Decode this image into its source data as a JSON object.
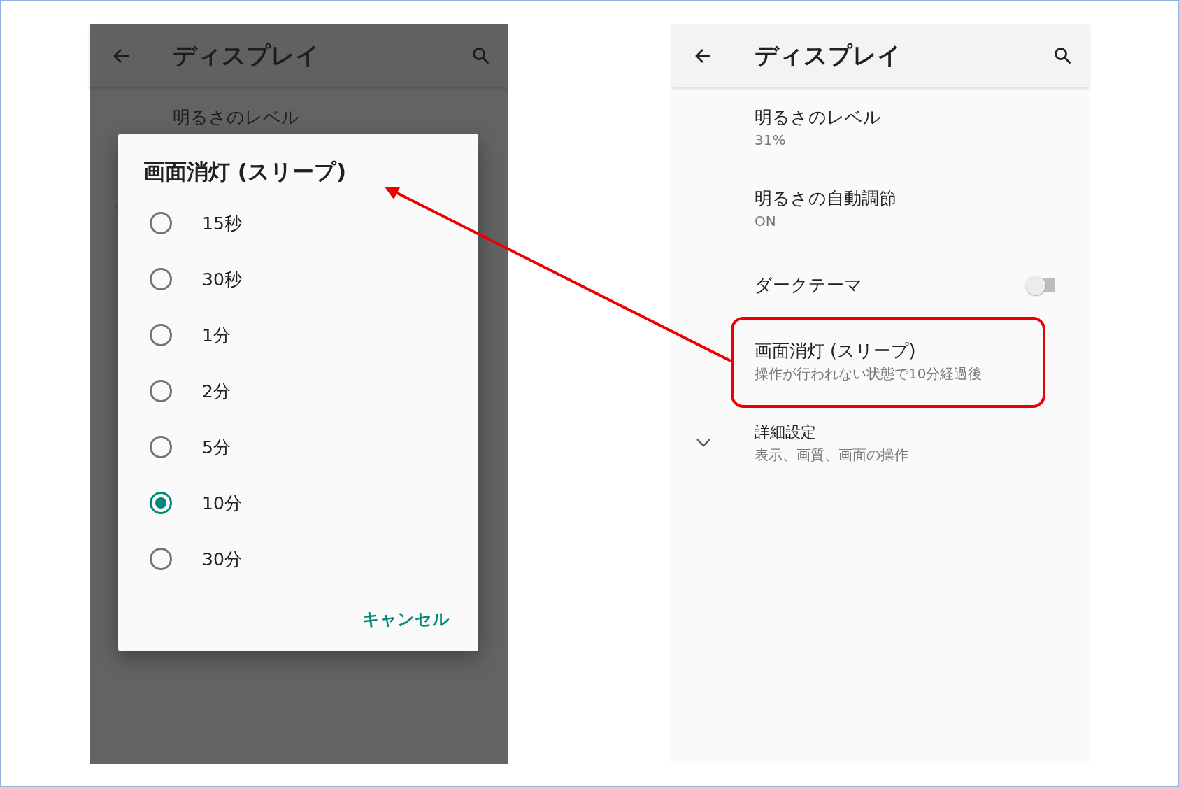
{
  "panels": [
    {
      "kind": "dialog",
      "header": {
        "title": "ディスプレイ"
      },
      "items": [
        {
          "kind": "text",
          "title": "明るさのレベル"
        },
        {
          "kind": "expand"
        }
      ],
      "dialog": {
        "title": "画面消灯 (スリープ)",
        "options": [
          {
            "label": "15秒",
            "selected": false
          },
          {
            "label": "30秒",
            "selected": false
          },
          {
            "label": "1分",
            "selected": false
          },
          {
            "label": "2分",
            "selected": false
          },
          {
            "label": "5分",
            "selected": false
          },
          {
            "label": "10分",
            "selected": true
          },
          {
            "label": "30分",
            "selected": false
          }
        ],
        "cancel": "キャンセル"
      }
    },
    {
      "kind": "list",
      "header": {
        "title": "ディスプレイ"
      },
      "items": [
        {
          "kind": "text",
          "title": "明るさのレベル",
          "summary": "31%"
        },
        {
          "kind": "text",
          "title": "明るさの自動調節",
          "summary": "ON"
        },
        {
          "kind": "switch",
          "title": "ダークテーマ",
          "on": false
        },
        {
          "kind": "text",
          "title": "画面消灯 (スリープ)",
          "summary": "操作が行われない状態で10分経過後",
          "highlighted": true
        },
        {
          "kind": "expand",
          "title": "詳細設定",
          "summary": "表示、画質、画面の操作"
        }
      ]
    }
  ]
}
